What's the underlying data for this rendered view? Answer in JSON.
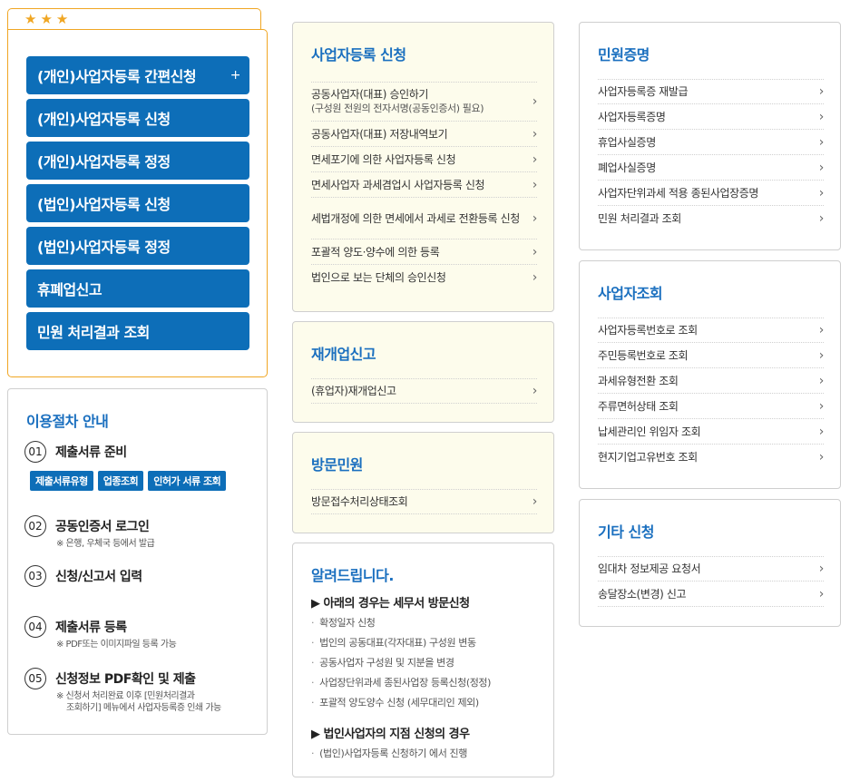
{
  "favorites": {
    "stars": [
      "★",
      "★",
      "★"
    ],
    "buttons": [
      {
        "label": "(개인)사업자등록 간편신청",
        "extra": "+"
      },
      {
        "label": "(개인)사업자등록 신청"
      },
      {
        "label": "(개인)사업자등록 정정"
      },
      {
        "label": "(법인)사업자등록 신청"
      },
      {
        "label": "(법인)사업자등록 정정"
      },
      {
        "label": "휴폐업신고"
      },
      {
        "label": "민원 처리결과 조회"
      }
    ]
  },
  "guide": {
    "title": "이용절차 안내",
    "steps": [
      {
        "num": "01",
        "title": "제출서류 준비",
        "tags": [
          "제출서류유형",
          "업종조회",
          "인허가 서류 조회"
        ]
      },
      {
        "num": "02",
        "title": "공동인증서 로그인",
        "note": "※ 은행, 우체국 등에서 발급"
      },
      {
        "num": "03",
        "title": "신청/신고서 입력"
      },
      {
        "num": "04",
        "title": "제출서류 등록",
        "note": "※ PDF또는 이미지파일 등록 가능"
      },
      {
        "num": "05",
        "title": "신청정보 PDF확인 및 제출",
        "note1": "※ 신청서 처리완료 이후 [민원처리결과",
        "note2": "조회하기] 메뉴에서 사업자등록증 인쇄 가능"
      }
    ]
  },
  "registration": {
    "title": "사업자등록 신청",
    "items": [
      {
        "label": "공동사업자(대표) 승인하기",
        "sub": "(구성원 전원의 전자서명(공동인증서) 필요)"
      },
      {
        "label": "공동사업자(대표) 저장내역보기"
      },
      {
        "label": "면세포기에 의한 사업자등록 신청"
      },
      {
        "label": "면세사업자 과세겸업시 사업자등록 신청"
      },
      {
        "label": "세법개정에 의한 면세에서 과세로 전환등록 신청"
      },
      {
        "label": "포괄적 양도·양수에 의한 등록"
      },
      {
        "label": "법인으로 보는 단체의 승인신청"
      }
    ]
  },
  "reopen": {
    "title": "재개업신고",
    "items": [
      {
        "label": "(휴업자)재개업신고"
      }
    ]
  },
  "visit": {
    "title": "방문민원",
    "items": [
      {
        "label": "방문접수처리상태조회"
      }
    ]
  },
  "notice": {
    "title": "알려드립니다.",
    "section1": "▶ 아래의 경우는 세무서 방문신청",
    "list1": [
      "확정일자 신청",
      "법인의 공동대표(각자대표) 구성원 변동",
      "공동사업자 구성원 및 지분을 변경",
      "사업장단위과세 종된사업장 등록신청(정정)",
      "포괄적 양도양수 신청 (세무대리인 제외)"
    ],
    "section2": "▶ 법인사업자의 지점 신청의 경우",
    "list2": [
      "(법인)사업자등록 신청하기 에서 진행"
    ]
  },
  "certificate": {
    "title": "민원증명",
    "items": [
      {
        "label": "사업자등록증 재발급"
      },
      {
        "label": "사업자등록증명"
      },
      {
        "label": "휴업사실증명"
      },
      {
        "label": "폐업사실증명"
      },
      {
        "label": "사업자단위과세 적용 종된사업장증명"
      },
      {
        "label": "민원 처리결과 조회"
      }
    ]
  },
  "lookup": {
    "title": "사업자조회",
    "items": [
      {
        "label": "사업자등록번호로 조회"
      },
      {
        "label": "주민등록번호로 조회"
      },
      {
        "label": "과세유형전환 조회"
      },
      {
        "label": "주류면허상태 조회"
      },
      {
        "label": "납세관리인 위임자 조회"
      },
      {
        "label": "현지기업고유번호 조회"
      }
    ]
  },
  "other": {
    "title": "기타 신청",
    "items": [
      {
        "label": "임대차 정보제공 요청서"
      },
      {
        "label": "송달장소(변경) 신고"
      }
    ]
  },
  "chevron": "›",
  "colors": {
    "primary": "#0d6eb8",
    "accent": "#f0a623",
    "title": "#1a6fbf",
    "cream": "#fdfcec"
  }
}
